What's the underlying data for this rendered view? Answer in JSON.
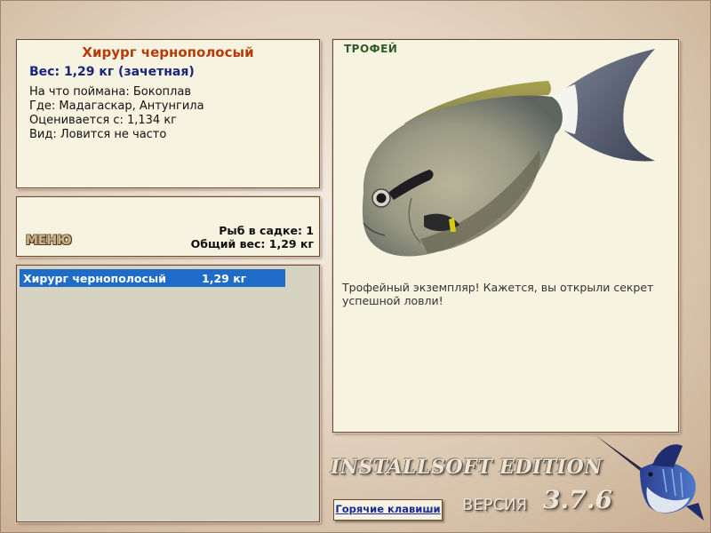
{
  "fish_info": {
    "name": "Хирург чернополосый",
    "weight": "Вес: 1,29 кг (зачетная)",
    "bait": "На что поймана: Бокоплав",
    "location": "Где: Мадагаскар, Антунгила",
    "value": "Оценивается с: 1,134 кг",
    "kind": "Вид: Ловится не часто"
  },
  "menu": {
    "label": "МЕНЮ",
    "fish_count": "Рыб в садке: 1",
    "total_weight": "Общий вес: 1,29 кг"
  },
  "catch_list": [
    {
      "name": "Хирург чернополосый",
      "weight": "1,29 кг"
    }
  ],
  "trophy": {
    "label": "ТРОФЕЙ",
    "text": "Трофейный экземпляр! Кажется, вы открыли секрет успешной ловли!"
  },
  "footer": {
    "edition": "INSTALLSOFT EDITION",
    "hotkeys": "Горячие клавиши",
    "version_label": "ВЕРСИЯ",
    "version_number": "3.7.6"
  },
  "icons": {
    "fish_image": "surgeonfish-image",
    "logo": "marlin-logo"
  },
  "colors": {
    "title": "#b43c0a",
    "weight": "#1a237e",
    "selection": "#1e6cc8",
    "panel": "#f6f3e0"
  }
}
